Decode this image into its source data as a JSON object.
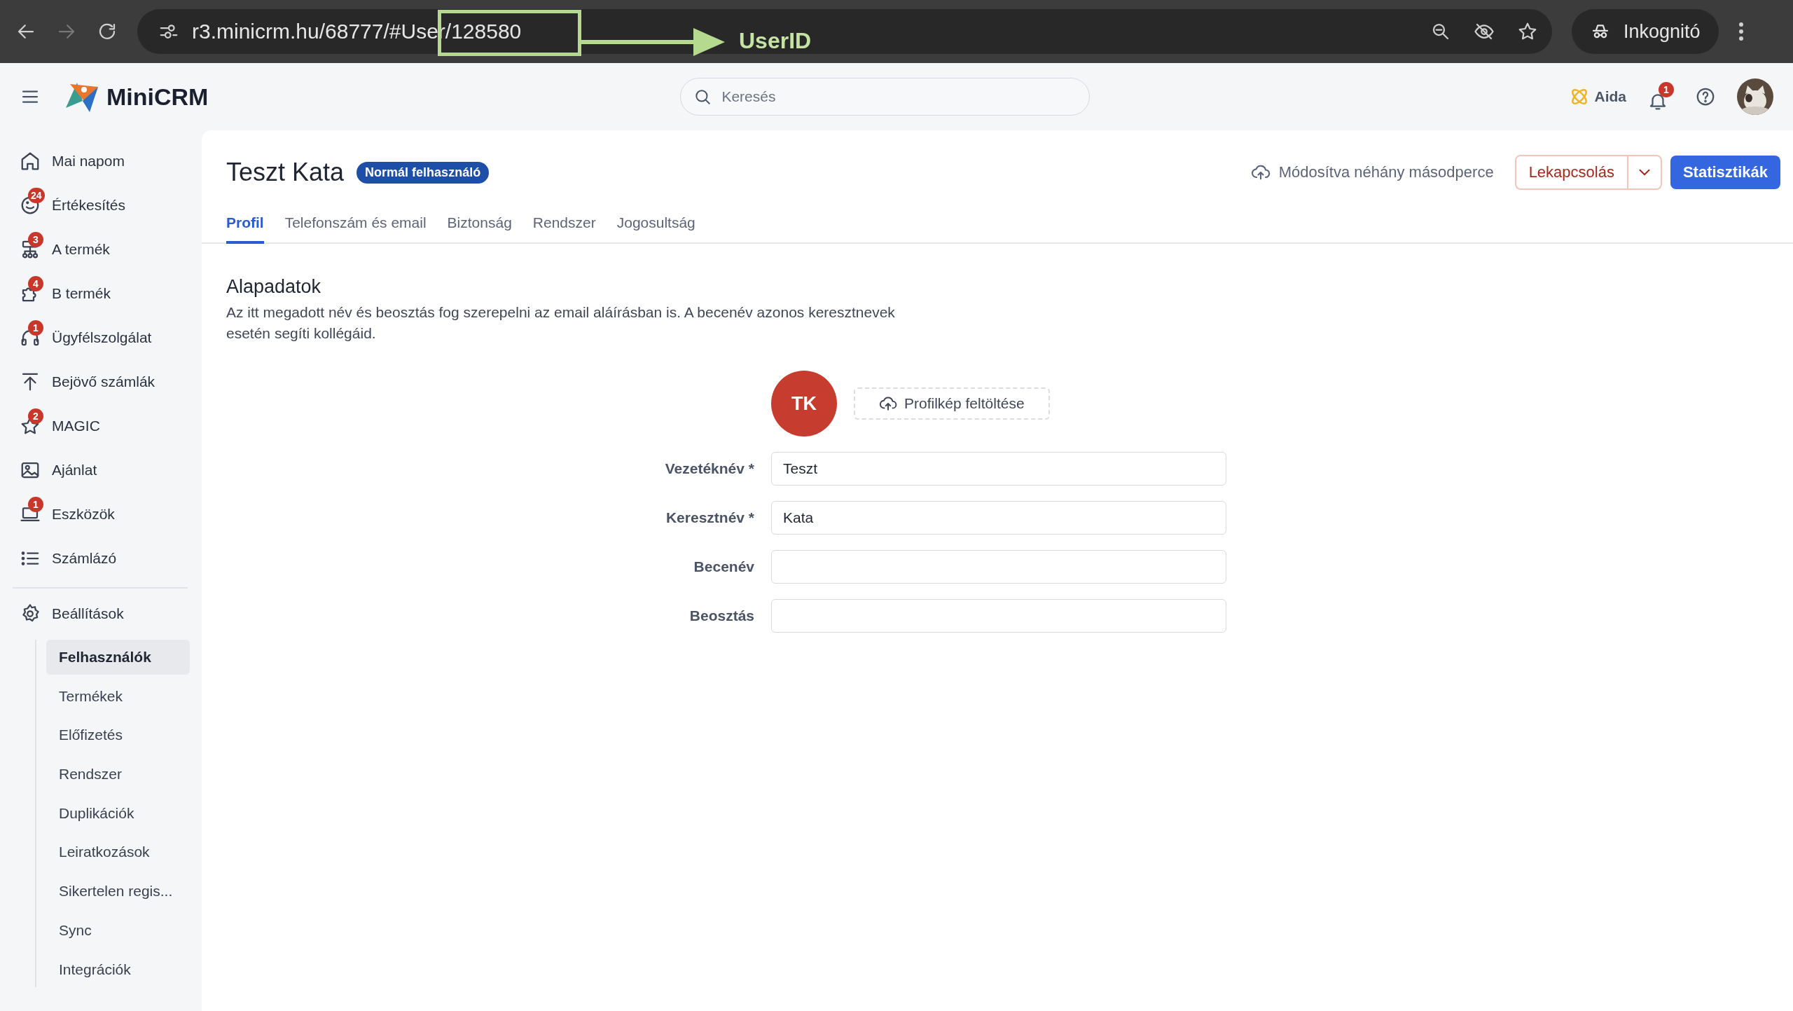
{
  "browser": {
    "url": "r3.minicrm.hu/68777/#User/128580",
    "profile": "Inkognitó"
  },
  "annotation": {
    "label": "UserID"
  },
  "header": {
    "logo": "MiniCRM",
    "search": {
      "placeholder": "Keresés"
    },
    "assistant": "Aida",
    "notifications": "1"
  },
  "sidebar": {
    "items": [
      {
        "label": "Mai napom"
      },
      {
        "label": "Értékesítés",
        "badge": "24"
      },
      {
        "label": "A termék",
        "badge": "3"
      },
      {
        "label": "B termék",
        "badge": "4"
      },
      {
        "label": "Ügyfélszolgálat",
        "badge": "1"
      },
      {
        "label": "Bejövő számlák"
      },
      {
        "label": "MAGIC",
        "badge": "2"
      },
      {
        "label": "Ajánlat"
      },
      {
        "label": "Eszközök",
        "badge": "1"
      },
      {
        "label": "Számlázó"
      }
    ],
    "settings": {
      "label": "Beállítások",
      "expanded": true,
      "children": [
        {
          "label": "Felhasználók",
          "selected": true
        },
        {
          "label": "Termékek",
          "selected": false
        },
        {
          "label": "Előfizetés",
          "selected": false
        },
        {
          "label": "Rendszer",
          "selected": false
        },
        {
          "label": "Duplikációk",
          "selected": false
        },
        {
          "label": "Leiratkozások",
          "selected": false
        },
        {
          "label": "Sikertelen regis...",
          "selected": false
        },
        {
          "label": "Sync",
          "selected": false
        },
        {
          "label": "Integrációk",
          "selected": false
        }
      ]
    }
  },
  "page": {
    "title": "Teszt Kata",
    "role": "Normál felhasználó",
    "status": "Módosítva néhány másodperce",
    "actions": {
      "disable": "Lekapcsolás",
      "stats": "Statisztikák"
    },
    "tabs": [
      {
        "label": "Profil",
        "selected": true
      },
      {
        "label": "Telefonszám és email",
        "selected": false
      },
      {
        "label": "Biztonság",
        "selected": false
      },
      {
        "label": "Rendszer",
        "selected": false
      },
      {
        "label": "Jogosultság",
        "selected": false
      }
    ],
    "section": {
      "heading": "Alapadatok",
      "description": "Az itt megadott név és beosztás fog szerepelni az email aláírásban is. A becenév azonos keresztnevek esetén segíti kollégáid.",
      "initials": "TK",
      "upload": "Profilkép feltöltése",
      "fields": [
        {
          "label": "Vezetéknév *",
          "value": "Teszt"
        },
        {
          "label": "Keresztnév *",
          "value": "Kata"
        },
        {
          "label": "Becenév"
        },
        {
          "label": "Beosztás"
        }
      ]
    }
  }
}
